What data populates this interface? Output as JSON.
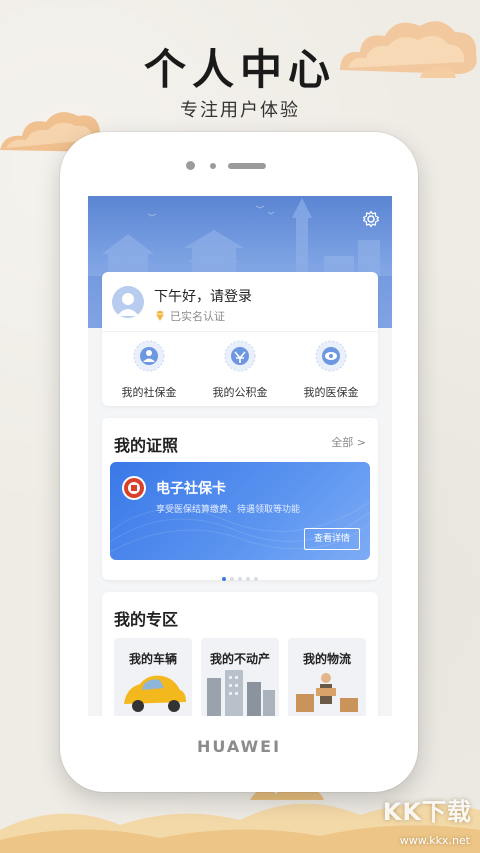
{
  "promo": {
    "title": "个人中心",
    "subtitle": "专注用户体验"
  },
  "device": {
    "brand": "HUAWEI"
  },
  "user": {
    "greeting": "下午好，请登录",
    "auth_status": "已实名认证"
  },
  "quick_actions": [
    {
      "label": "我的社保金",
      "icon": "social-security-icon"
    },
    {
      "label": "我的公积金",
      "icon": "housing-fund-icon"
    },
    {
      "label": "我的医保金",
      "icon": "medical-insurance-icon"
    }
  ],
  "certificates": {
    "title": "我的证照",
    "more": "全部 >",
    "card": {
      "title": "电子社保卡",
      "description": "享受医保结算缴费、待遇领取等功能",
      "button": "查看详情"
    },
    "pagination": {
      "count": 5,
      "active": 0
    }
  },
  "zone": {
    "title": "我的专区",
    "items": [
      {
        "label": "我的车辆"
      },
      {
        "label": "我的不动产"
      },
      {
        "label": "我的物流"
      }
    ]
  },
  "watermark": {
    "text": "KK下载",
    "url": "www.kkx.net"
  },
  "colors": {
    "accent": "#3a78e8",
    "banner": "#5b85d3",
    "background": "#efece5",
    "gold": "#e8c77a"
  }
}
